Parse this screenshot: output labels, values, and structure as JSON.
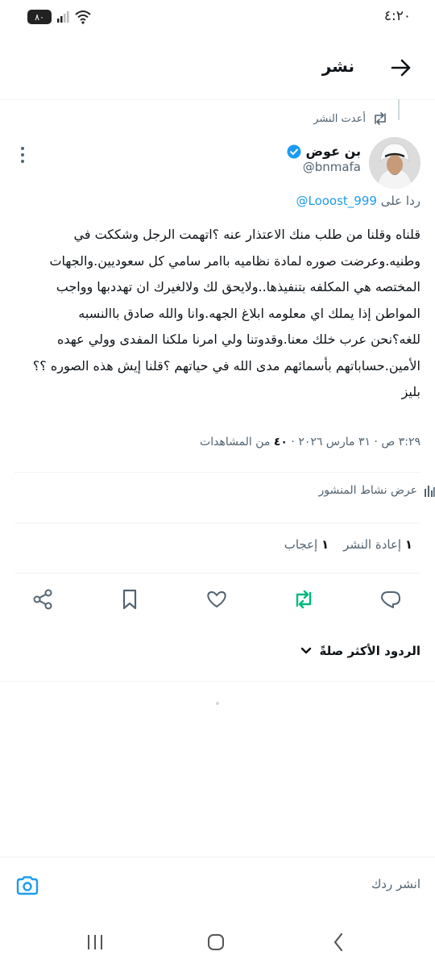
{
  "status_bar": {
    "time": "٤:٢٠",
    "battery": "٨٠"
  },
  "header": {
    "title": "نشر"
  },
  "reposted": {
    "label": "أعدت النشر"
  },
  "author": {
    "name": "بن عوض",
    "handle": "@bnmafa"
  },
  "reply_to": {
    "prefix": "ردا على",
    "handle": "@Looost_999"
  },
  "tweet": {
    "lines": [
      "قلناه وقلنا من طلب منك الاعتذار عنه ؟اتهمت الرجل وشككت في",
      "وطنيه.وعرضت صوره لمادة نظاميه باامر سامي كل سعوديين.والجهات",
      "المختصه هي المكلفه بتنفيذها..ولايحق لك ولالغيرك ان تهددبها وواجب",
      "المواطن إذا يملك اي معلومه ابلاغ الجهه.وانا والله صادق باالنسبه",
      "للغه؟نحن عرب خلك معنا.وقدوتنا ولي امرنا ملكنا المفدى وولي عهده",
      "الأمين.حساباتهم بأسمائهم مدى الله في حياتهم ؟قلنا إيش هذه الصوره ؟؟",
      "بليز"
    ]
  },
  "meta": {
    "timestamp": "٣:٢٩ ص · ٣١ مارس ٢٠٢٦ · ",
    "views_count": "٤٠",
    "views_label": " من المشاهدات"
  },
  "activity": {
    "label": "عرض نشاط المنشور"
  },
  "stats": {
    "reposts_count": "١",
    "reposts_label": "إعادة النشر",
    "likes_count": "١",
    "likes_label": "إعجاب"
  },
  "replies_sort": {
    "label": "الردود الأكثر صلةً"
  },
  "composer": {
    "placeholder": "انشر ردك"
  },
  "colors": {
    "accent": "#1d9bf0",
    "repost_green": "#00ba7c",
    "text": "#0f1419",
    "muted": "#536471"
  }
}
